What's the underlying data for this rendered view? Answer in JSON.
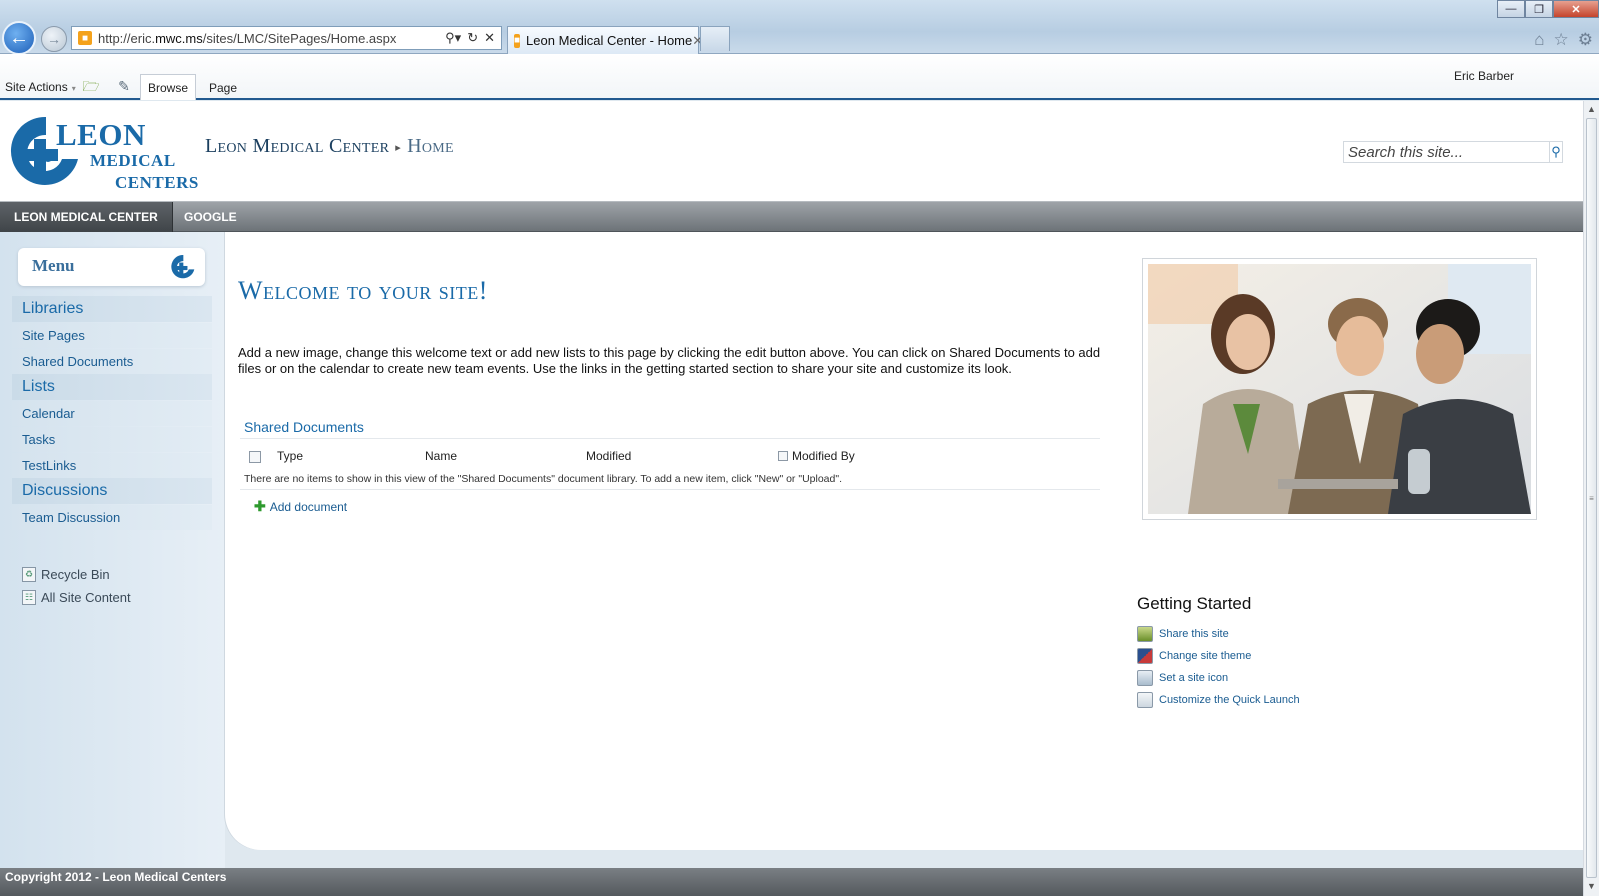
{
  "browser": {
    "url_prefix": "http://eric.",
    "url_host": "mwc.ms",
    "url_path": "/sites/LMC/SitePages/Home.aspx",
    "tab_title": "Leon Medical Center - Home"
  },
  "ribbon": {
    "site_actions": "Site Actions",
    "tabs": [
      "Browse",
      "Page"
    ],
    "user": "Eric Barber"
  },
  "header": {
    "logo": {
      "line1": "LEON",
      "line2": "MEDICAL",
      "line3": "CENTERS"
    },
    "breadcrumb": {
      "site": "Leon Medical Center",
      "current": "Home"
    },
    "search_placeholder": "Search this site..."
  },
  "topnav": {
    "items": [
      "LEON MEDICAL CENTER",
      "GOOGLE"
    ]
  },
  "leftnav": {
    "menu_title": "Menu",
    "sections": [
      {
        "heading": "Libraries",
        "links": [
          "Site Pages",
          "Shared Documents"
        ]
      },
      {
        "heading": "Lists",
        "links": [
          "Calendar",
          "Tasks",
          "TestLinks"
        ]
      },
      {
        "heading": "Discussions",
        "links": [
          "Team Discussion"
        ]
      }
    ],
    "utility": [
      "Recycle Bin",
      "All Site Content"
    ]
  },
  "main": {
    "welcome_title": "Welcome to your site!",
    "welcome_text": "Add a new image, change this welcome text or add new lists to this page by clicking the edit button above. You can click on Shared Documents to add files or on the calendar to create new team events. Use the links in the getting started section to share your site and customize its look.",
    "shared_docs": {
      "title": "Shared Documents",
      "columns": [
        "Type",
        "Name",
        "Modified",
        "Modified By"
      ],
      "empty_message": "There are no items to show in this view of the \"Shared Documents\" document library. To add a new item, click \"New\" or \"Upload\".",
      "add_label": "Add document"
    },
    "getting_started": {
      "title": "Getting Started",
      "links": [
        "Share this site",
        "Change site theme",
        "Set a site icon",
        "Customize the Quick Launch"
      ]
    }
  },
  "footer": {
    "copyright": "Copyright 2012 - Leon Medical Centers"
  },
  "colors": {
    "brand_blue": "#1a6aa8",
    "ribbon_border": "#21598f",
    "nav_gray": "#6d7378"
  }
}
